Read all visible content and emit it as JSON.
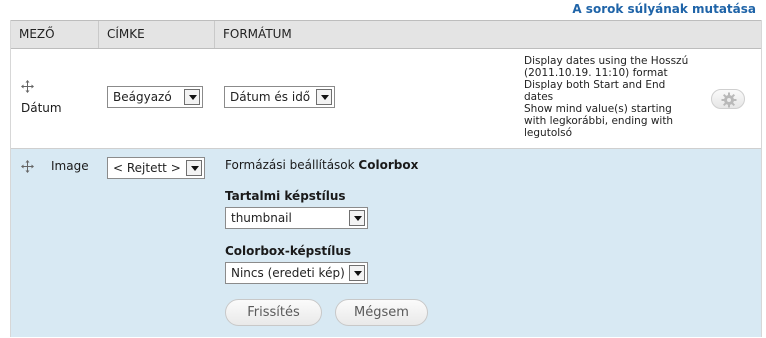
{
  "top_link": "A sorok súlyának mutatása",
  "table": {
    "headers": [
      "MEZŐ",
      "CÍMKE",
      "FORMÁTUM"
    ]
  },
  "rows": [
    {
      "field": "Dátum",
      "label_select": "Beágyazó",
      "format_select": "Dátum és idő",
      "summary": [
        "Display dates using the Hosszú",
        "(2011.10.19. 11:10) format",
        "Display both Start and End",
        "dates",
        "Show mind value(s) starting",
        "with legkorábbi, ending with",
        "legutolsó"
      ],
      "settings_icon": "gear-icon"
    },
    {
      "field": "Image",
      "label_select": "< Rejtett >",
      "format_settings_prefix": "Formázási beállítások",
      "format_settings_name": "Colorbox",
      "content_style_label": "Tartalmi képstílus",
      "content_style_value": "thumbnail",
      "colorbox_style_label": "Colorbox-képstílus",
      "colorbox_style_value": "Nincs (eredeti kép)",
      "update_button": "Frissítés",
      "cancel_button": "Mégsem"
    }
  ],
  "colors": {
    "link": "#1f64a8",
    "header_bg": "#e4e4e4",
    "edit_row_bg": "#d8e9f3"
  }
}
